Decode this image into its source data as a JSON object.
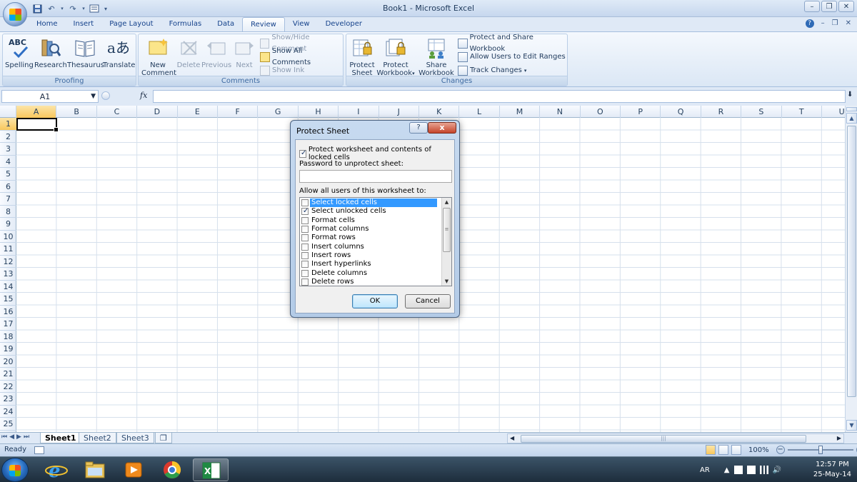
{
  "window": {
    "title": "Book1 - Microsoft Excel"
  },
  "ribbon": {
    "tabs": [
      "Home",
      "Insert",
      "Page Layout",
      "Formulas",
      "Data",
      "Review",
      "View",
      "Developer"
    ],
    "active_tab": "Review",
    "proofing": {
      "label": "Proofing",
      "buttons": [
        "Spelling",
        "Research",
        "Thesaurus",
        "Translate"
      ],
      "spelling_icon_text": "ABC"
    },
    "comments": {
      "label": "Comments",
      "new_comment_line1": "New",
      "new_comment_line2": "Comment",
      "delete": "Delete",
      "previous": "Previous",
      "next": "Next",
      "show_hide": "Show/Hide Comment",
      "show_all": "Show All Comments",
      "show_ink": "Show Ink"
    },
    "changes": {
      "label": "Changes",
      "protect_sheet_line1": "Protect",
      "protect_sheet_line2": "Sheet",
      "protect_workbook_line1": "Protect",
      "protect_workbook_line2": "Workbook",
      "share_workbook_line1": "Share",
      "share_workbook_line2": "Workbook",
      "protect_share": "Protect and Share Workbook",
      "allow_users": "Allow Users to Edit Ranges",
      "track_changes": "Track Changes"
    }
  },
  "formula_bar": {
    "name_box": "A1",
    "fx": "fx",
    "value": ""
  },
  "grid": {
    "columns": [
      "A",
      "B",
      "C",
      "D",
      "E",
      "F",
      "G",
      "H",
      "I",
      "J",
      "K",
      "L",
      "M",
      "N",
      "O",
      "P",
      "Q",
      "R",
      "S",
      "T",
      "U"
    ],
    "rows": [
      "1",
      "2",
      "3",
      "4",
      "5",
      "6",
      "7",
      "8",
      "9",
      "10",
      "11",
      "12",
      "13",
      "14",
      "15",
      "16",
      "17",
      "18",
      "19",
      "20",
      "21",
      "22",
      "23",
      "24",
      "25"
    ],
    "active_cell": "A1"
  },
  "sheets": {
    "tabs": [
      "Sheet1",
      "Sheet2",
      "Sheet3"
    ],
    "active": "Sheet1"
  },
  "status": {
    "text": "Ready",
    "zoom": "100%",
    "zoom_level": 100
  },
  "dialog": {
    "title": "Protect Sheet",
    "help": "?",
    "close": "x",
    "protect_label": "Protect worksheet and contents of locked cells",
    "protect_checked": true,
    "password_label": "Password to unprotect sheet:",
    "password_value": "",
    "allow_label": "Allow all users of this worksheet to:",
    "permissions": [
      {
        "label": "Select locked cells",
        "checked": false,
        "highlighted": true
      },
      {
        "label": "Select unlocked cells",
        "checked": true,
        "highlighted": false
      },
      {
        "label": "Format cells",
        "checked": false,
        "highlighted": false
      },
      {
        "label": "Format columns",
        "checked": false,
        "highlighted": false
      },
      {
        "label": "Format rows",
        "checked": false,
        "highlighted": false
      },
      {
        "label": "Insert columns",
        "checked": false,
        "highlighted": false
      },
      {
        "label": "Insert rows",
        "checked": false,
        "highlighted": false
      },
      {
        "label": "Insert hyperlinks",
        "checked": false,
        "highlighted": false
      },
      {
        "label": "Delete columns",
        "checked": false,
        "highlighted": false
      },
      {
        "label": "Delete rows",
        "checked": false,
        "highlighted": false
      }
    ],
    "ok": "OK",
    "cancel": "Cancel"
  },
  "taskbar": {
    "apps": [
      "start-orb",
      "internet-explorer-icon",
      "file-explorer-icon",
      "media-player-icon",
      "chrome-icon",
      "excel-icon"
    ],
    "language": "AR",
    "time": "12:57 PM",
    "date": "25-May-14"
  }
}
